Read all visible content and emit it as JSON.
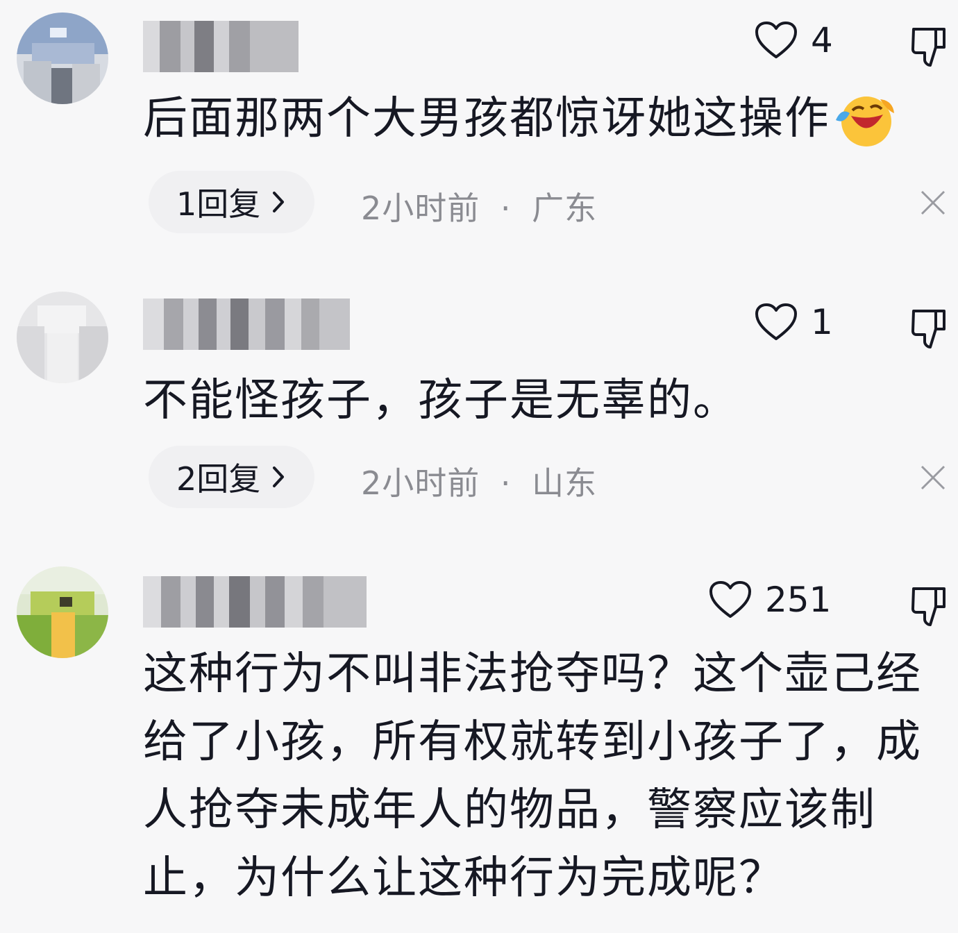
{
  "comments": [
    {
      "text": "后面那两个大男孩都惊讶她这操作",
      "likes": "4",
      "replies": "1回复",
      "time": "2小时前",
      "location": "广东",
      "meta_sep": "·",
      "emoji": "laughing-tears-emoji"
    },
    {
      "text": "不能怪孩子，孩子是无辜的。",
      "likes": "1",
      "replies": "2回复",
      "time": "2小时前",
      "location": "山东",
      "meta_sep": "·"
    },
    {
      "text_lines": [
        "这种行为不叫非法抢夺吗？这个壶己经",
        "给了小孩，所有权就转到小孩子了，成",
        "人抢夺未成年人的物品，警察应该制",
        "止，为什么让这种行为完成呢？"
      ],
      "likes": "251"
    }
  ],
  "colors": {
    "primary_text": "#161823",
    "secondary_text": "#8a8b91",
    "background": "#f7f7f8"
  }
}
